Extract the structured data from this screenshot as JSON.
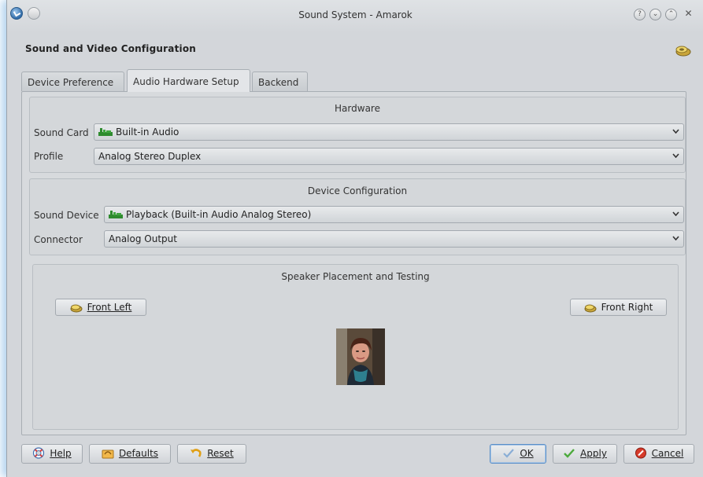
{
  "window": {
    "title": "Sound System - Amarok",
    "buttons": [
      "?",
      "⌄",
      "⌃",
      "✕"
    ]
  },
  "dialog": {
    "heading": "Sound and Video Configuration"
  },
  "tabs": [
    {
      "label": "Device Preference",
      "active": false
    },
    {
      "label": "Audio Hardware Setup",
      "active": true
    },
    {
      "label": "Backend",
      "active": false
    }
  ],
  "hardware": {
    "title": "Hardware",
    "sound_card_label": "Sound Card",
    "sound_card_value": "Built-in Audio",
    "profile_label": "Profile",
    "profile_value": "Analog Stereo Duplex"
  },
  "device_config": {
    "title": "Device Configuration",
    "sound_device_label": "Sound Device",
    "sound_device_value": "Playback (Built-in Audio Analog Stereo)",
    "connector_label": "Connector",
    "connector_value": "Analog Output"
  },
  "speakers": {
    "title": "Speaker Placement and Testing",
    "front_left": "Front Left",
    "front_right": "Front Right"
  },
  "footer": {
    "help": "Help",
    "defaults": "Defaults",
    "reset": "Reset",
    "ok": "OK",
    "apply": "Apply",
    "cancel": "Cancel"
  },
  "colors": {
    "window_bg": "#d3d6da",
    "panel_bg": "#d7dadd",
    "accent": "#5a8fc8",
    "card_icon": "#2e8b2e"
  }
}
